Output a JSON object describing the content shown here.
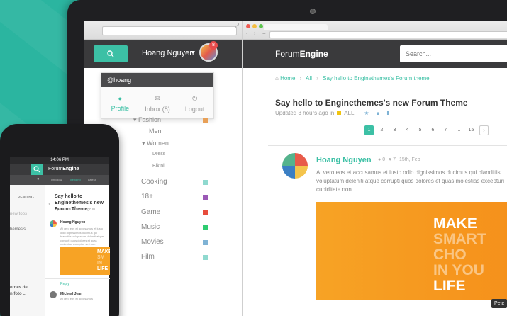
{
  "laptop_left": {
    "user_name": "Hoang Nguyen",
    "badge_count": "8",
    "dropdown": {
      "handle": "@hoang",
      "items": [
        {
          "label": "Profile",
          "icon": "user-icon"
        },
        {
          "label": "Inbox (8)",
          "icon": "mail-icon"
        },
        {
          "label": "Logout",
          "icon": "power-icon"
        }
      ]
    },
    "categories": [
      {
        "label": "Fashion",
        "color": "#e8a057"
      },
      {
        "label": "Men",
        "color": ""
      },
      {
        "label": "Women",
        "color": ""
      },
      {
        "label": "Dress",
        "color": ""
      },
      {
        "label": "Bikini",
        "color": ""
      },
      {
        "label": "Cooking",
        "color": "#8fd9cf"
      },
      {
        "label": "18+",
        "color": "#9b59b6"
      },
      {
        "label": "Game",
        "color": "#e74c3c"
      },
      {
        "label": "Music",
        "color": "#2ecc71"
      },
      {
        "label": "Movies",
        "color": "#7fb3d5"
      },
      {
        "label": "Film",
        "color": "#8fd9cf"
      }
    ]
  },
  "laptop_right": {
    "logo_light": "Forum",
    "logo_bold": "Engine",
    "search_placeholder": "Search...",
    "breadcrumb": [
      "Home",
      "All",
      "Say hello to Enginethemes's Forum theme"
    ],
    "thread": {
      "title": "Say hello to Enginethemes's new Forum Theme",
      "meta": "Updated 3 hours ago in",
      "category": "ALL"
    },
    "pagination": [
      "1",
      "2",
      "3",
      "4",
      "5",
      "6",
      "7",
      "...",
      "15",
      "›"
    ],
    "post": {
      "author": "Hoang Nguyen",
      "comments": "0",
      "likes": "7",
      "date": "15th, Feb",
      "text": "At vero eos et accusamus et iusto odio dignissimos ducimus qui blanditiis voluptatum deleniti atque corrupti quos dolores et quas molestias excepturi cupiditate non.",
      "image_lines": [
        "MAKE",
        "SMART",
        "CHO",
        "IN YOU",
        "LIFE"
      ]
    },
    "tooltip": "Pete"
  },
  "phone": {
    "time": "14:06 PM",
    "logo_light": "Forum",
    "logo_bold": "Engine",
    "filters": [
      "Unfollow",
      "Trending",
      "Latest"
    ],
    "pending": "PENDING",
    "left_texts": [
      "new tops",
      "hemes's",
      "ernes de",
      "n foto ..."
    ],
    "thread_title": "Say hello to Enginethemes's new Forum Theme",
    "thread_meta": "Updated 3 minutes ago in",
    "post_author": "Hoang Nguyen",
    "post_body": "At vero eos et accusamus et iusto odio dignissimos ducimus qui blanditiis voluptatum deleniti atque corrupti quos dolores et quas molestias excepturi sint non providunt.",
    "image_lines": [
      "MAKE",
      "SM",
      "IN",
      "LIFE"
    ],
    "reply": "Reply",
    "second_author": "Micheal Jean",
    "second_body": "At vero eos et accusamus"
  }
}
